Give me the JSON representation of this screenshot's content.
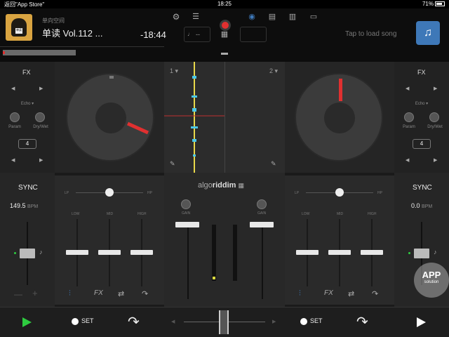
{
  "status_bar": {
    "back_app": "返回\"App Store\"",
    "clock": "18:25",
    "battery": "71%"
  },
  "deck_a": {
    "artist": "单向空间",
    "title": "单读 Vol.112 ...",
    "remaining_time": "-18:44",
    "pitch_readout": "--",
    "number": "1",
    "fx_label": "FX",
    "fx_effect": "Echo",
    "knob_labels": [
      "Param",
      "Dry/Wet"
    ],
    "loop_size": "4",
    "sync_label": "SYNC",
    "bpm_value": "149.5",
    "bpm_unit": "BPM",
    "eq_labels": [
      "LOW",
      "MID",
      "HIGH"
    ],
    "filter_labels": [
      "LP",
      "HP"
    ],
    "set_label": "SET"
  },
  "deck_b": {
    "tap_text": "Tap to load song",
    "number": "2",
    "fx_label": "FX",
    "fx_effect": "Echo",
    "knob_labels": [
      "Param",
      "Dry/Wet"
    ],
    "loop_size": "4",
    "sync_label": "SYNC",
    "bpm_value": "0.0",
    "bpm_unit": "BPM",
    "eq_labels": [
      "LOW",
      "MID",
      "HIGH"
    ],
    "filter_labels": [
      "LP",
      "HP"
    ],
    "set_label": "SET"
  },
  "mixer": {
    "logo_prefix": "algo",
    "logo_brand": "riddim",
    "gain_label": "GAIN"
  },
  "watermark": {
    "text": "APP",
    "sub": "solution"
  },
  "colors": {
    "accent_blue": "#3e78b8",
    "record_red": "#e03030",
    "needle_red": "#e03030",
    "play_green": "#2ecc40"
  }
}
